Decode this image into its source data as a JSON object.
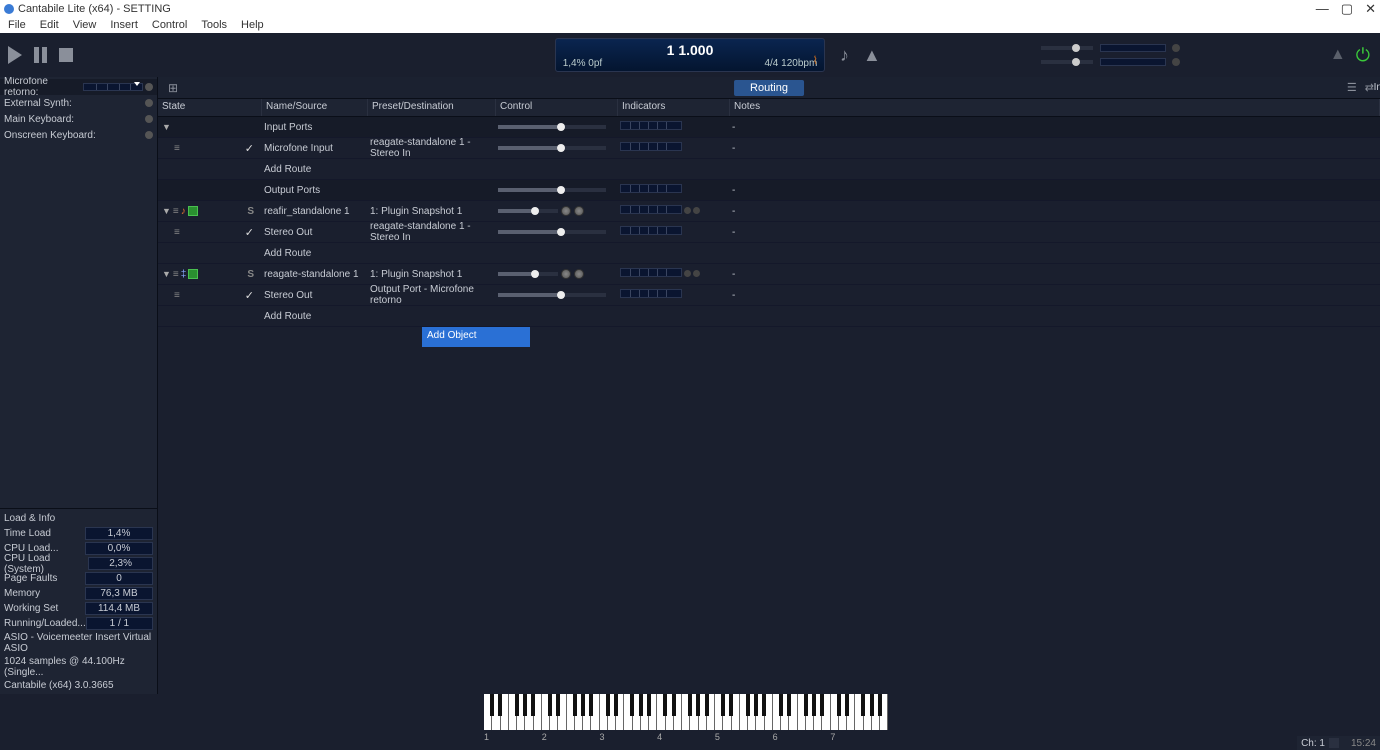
{
  "app": {
    "title": "Cantabile Lite (x64) - SETTING"
  },
  "menu": [
    "File",
    "Edit",
    "View",
    "Insert",
    "Control",
    "Tools",
    "Help"
  ],
  "transport": {
    "time": "1 1.000",
    "load": "1,4%  0pf",
    "tempo": "4/4 120bpm"
  },
  "sidebar": {
    "ports": [
      {
        "name": "Microfone retorno:"
      },
      {
        "name": "External Synth:"
      },
      {
        "name": "Main Keyboard:"
      },
      {
        "name": "Onscreen Keyboard:"
      }
    ],
    "load_title": "Load & Info",
    "rows": [
      {
        "label": "Time Load",
        "value": "1,4%"
      },
      {
        "label": "CPU Load...",
        "value": "0,0%"
      },
      {
        "label": "CPU Load (System)",
        "value": "2,3%"
      },
      {
        "label": "Page Faults",
        "value": "0"
      },
      {
        "label": "Memory",
        "value": "76,3 MB"
      },
      {
        "label": "Working Set",
        "value": "114,4 MB"
      },
      {
        "label": "Running/Loaded...",
        "value": "1 / 1"
      }
    ],
    "lines": [
      "ASIO - Voicemeeter Insert Virtual ASIO",
      "1024 samples @ 44.100Hz (Single...",
      "Cantabile (x64) 3.0.3665"
    ]
  },
  "tab": "Routing",
  "extras": {
    "in": "In"
  },
  "headers": {
    "state": "State",
    "name": "Name/Source",
    "preset": "Preset/Destination",
    "control": "Control",
    "indicators": "Indicators",
    "notes": "Notes"
  },
  "rows": [
    {
      "style": "dark",
      "exp": "▼",
      "name": "Input Ports",
      "slider": true,
      "meter": true,
      "note": "-"
    },
    {
      "style": "norm",
      "ham": true,
      "chk": true,
      "name": "Microfone  Input",
      "preset": "reagate-standalone 1 - Stereo In",
      "slider": true,
      "meter": true,
      "note": "-"
    },
    {
      "style": "norm",
      "name": "Add Route"
    },
    {
      "style": "dark",
      "name": "Output Ports",
      "slider": true,
      "meter": true,
      "note": "-"
    },
    {
      "style": "norm",
      "exp": "▼",
      "ham": true,
      "bypass": true,
      "green": true,
      "solo": true,
      "name": "reafir_standalone 1",
      "preset": "1: Plugin Snapshot 1",
      "slider": true,
      "knobs": true,
      "meter": true,
      "dots": true,
      "note": "-"
    },
    {
      "style": "norm",
      "ham": true,
      "chk": true,
      "name": "Stereo Out",
      "preset": "reagate-standalone 1 - Stereo In",
      "slider": true,
      "meter": true,
      "note": "-"
    },
    {
      "style": "norm",
      "name": "Add Route"
    },
    {
      "style": "norm",
      "exp": "▼",
      "ham": true,
      "bypass2": true,
      "green": true,
      "solo": true,
      "name": "reagate-standalone 1",
      "preset": "1: Plugin Snapshot 1",
      "slider": true,
      "knobs": true,
      "meter": true,
      "dots": true,
      "note": "-"
    },
    {
      "style": "norm",
      "ham": true,
      "chk": true,
      "name": "Stereo Out",
      "preset": "Output Port - Microfone retorno",
      "slider": true,
      "meter": true,
      "note": "-"
    },
    {
      "style": "norm",
      "name": "Add Route"
    }
  ],
  "add_object": "Add Object",
  "octaves": [
    "1",
    "2",
    "3",
    "4",
    "5",
    "6",
    "7"
  ],
  "status": {
    "ch": "Ch: 1",
    "time": "15:24"
  }
}
